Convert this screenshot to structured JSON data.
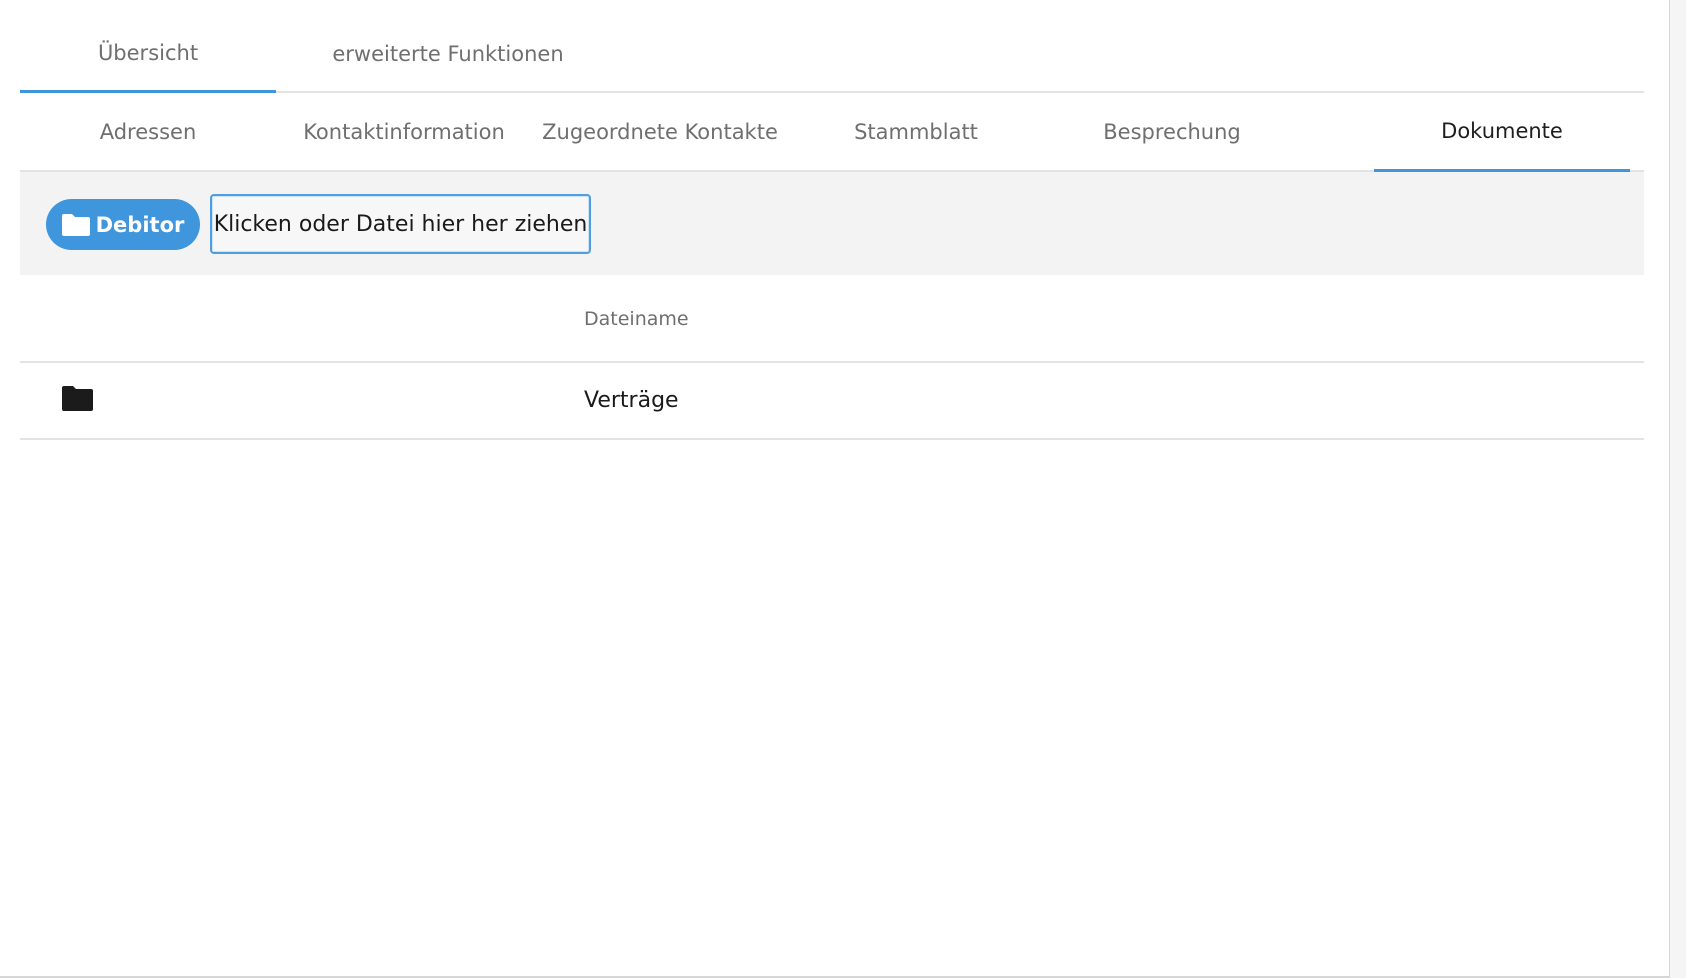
{
  "tabs_top": [
    {
      "label": "Übersicht",
      "active": true
    },
    {
      "label": "erweiterte Funktionen",
      "active": false
    }
  ],
  "tabs_sub": [
    {
      "label": "Adressen",
      "active": false
    },
    {
      "label": "Kontaktinformation",
      "active": false
    },
    {
      "label": "Zugeordnete Kontakte",
      "active": false
    },
    {
      "label": "Stammblatt",
      "active": false
    },
    {
      "label": "Besprechung",
      "active": false
    },
    {
      "label": "Dokumente",
      "active": true
    }
  ],
  "toolbar": {
    "folder_button_label": "Debitor",
    "folder_button_icon": "folder-icon",
    "dropzone_text": "Klicken oder Datei hier her ziehen"
  },
  "table": {
    "columns": [
      "",
      "Dateiname"
    ],
    "rows": [
      {
        "icon": "folder-icon",
        "name": "Verträge"
      }
    ]
  },
  "colors": {
    "accent": "#3f96dd",
    "toolbar_bg": "#f3f3f3",
    "divider": "#e3e3e3"
  }
}
